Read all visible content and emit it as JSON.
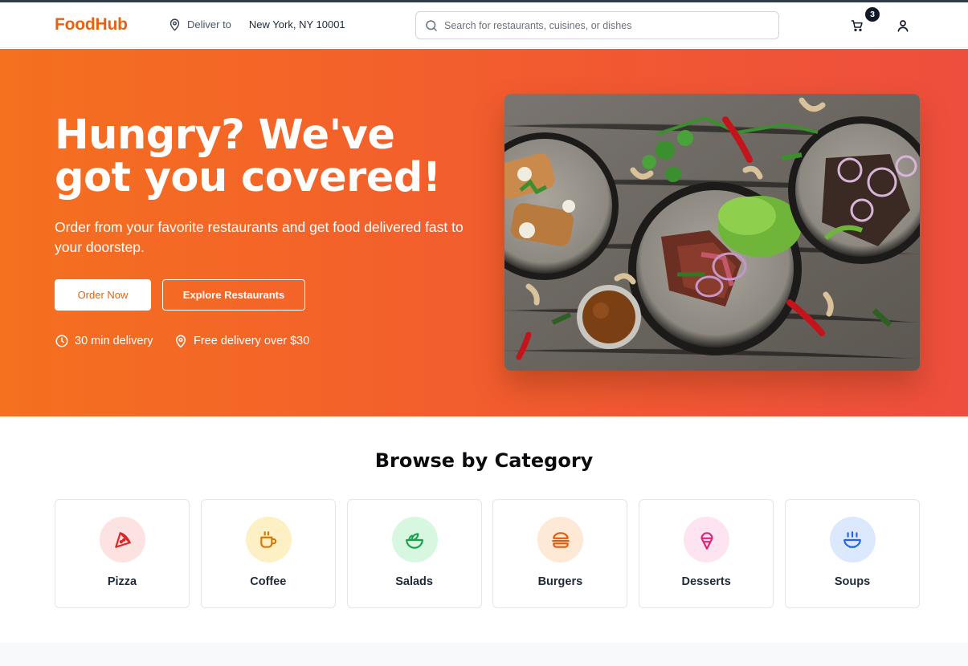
{
  "header": {
    "logo": "FoodHub",
    "deliver_label": "Deliver to",
    "deliver_location": "New York, NY 10001",
    "search_placeholder": "Search for restaurants, cuisines, or dishes",
    "cart_count": "3",
    "icons": [
      "map-pin-icon",
      "search-icon",
      "cart-icon",
      "user-icon"
    ]
  },
  "hero": {
    "title": "Hungry? We've got you covered!",
    "subtitle": "Order from your favorite restaurants and get food delivered fast to your doorstep.",
    "primary_button": "Order Now",
    "secondary_button": "Explore Restaurants",
    "features": [
      {
        "icon": "clock-icon",
        "text": "30 min delivery"
      },
      {
        "icon": "map-pin-icon",
        "text": "Free delivery over $30"
      }
    ]
  },
  "categories": {
    "title": "Browse by Category",
    "items": [
      {
        "label": "Pizza",
        "icon": "pizza-icon",
        "color": "#dc2626",
        "bg": "#fde2e2"
      },
      {
        "label": "Coffee",
        "icon": "coffee-icon",
        "color": "#d97706",
        "bg": "#fdf0c4"
      },
      {
        "label": "Salads",
        "icon": "salad-icon",
        "color": "#16a34a",
        "bg": "#d8f7e1"
      },
      {
        "label": "Burgers",
        "icon": "burger-icon",
        "color": "#ea580c",
        "bg": "#fee9d6"
      },
      {
        "label": "Desserts",
        "icon": "ice-cream-icon",
        "color": "#db2777",
        "bg": "#fde4f0"
      },
      {
        "label": "Soups",
        "icon": "soup-icon",
        "color": "#2563eb",
        "bg": "#dce8fd"
      }
    ]
  },
  "colors": {
    "brand": "#e8620e",
    "hero_gradient_start": "#f5701f",
    "hero_gradient_end": "#ee4e3e"
  }
}
